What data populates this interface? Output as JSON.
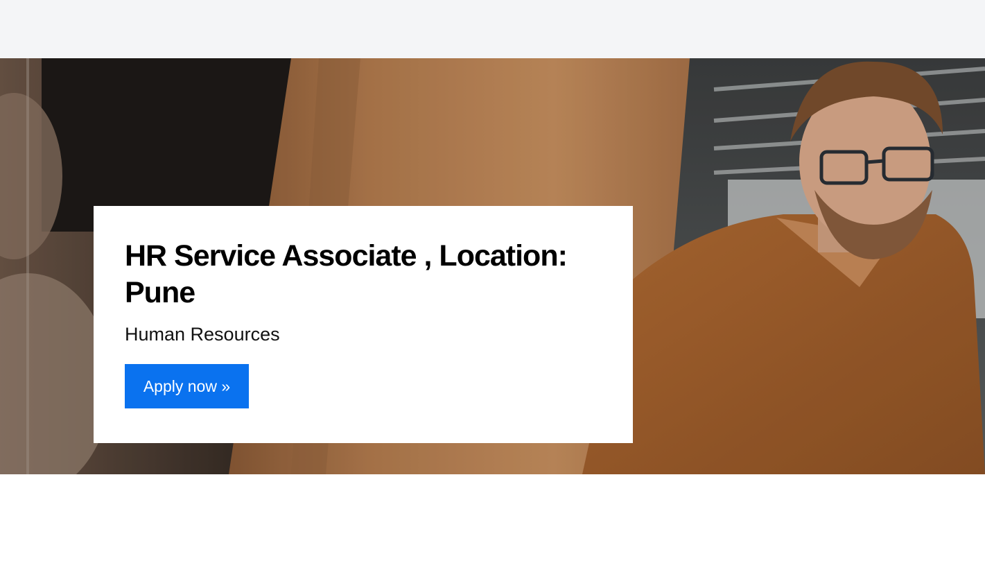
{
  "job": {
    "title": "HR Service Associate , Location: Pune",
    "department": "Human Resources",
    "apply_label": "Apply now »"
  },
  "colors": {
    "top_bar": "#f4f5f7",
    "apply_button": "#0a72ef",
    "card_background": "#ffffff"
  },
  "hero": {
    "image_description_icon": "office-photo-person-sweater"
  }
}
